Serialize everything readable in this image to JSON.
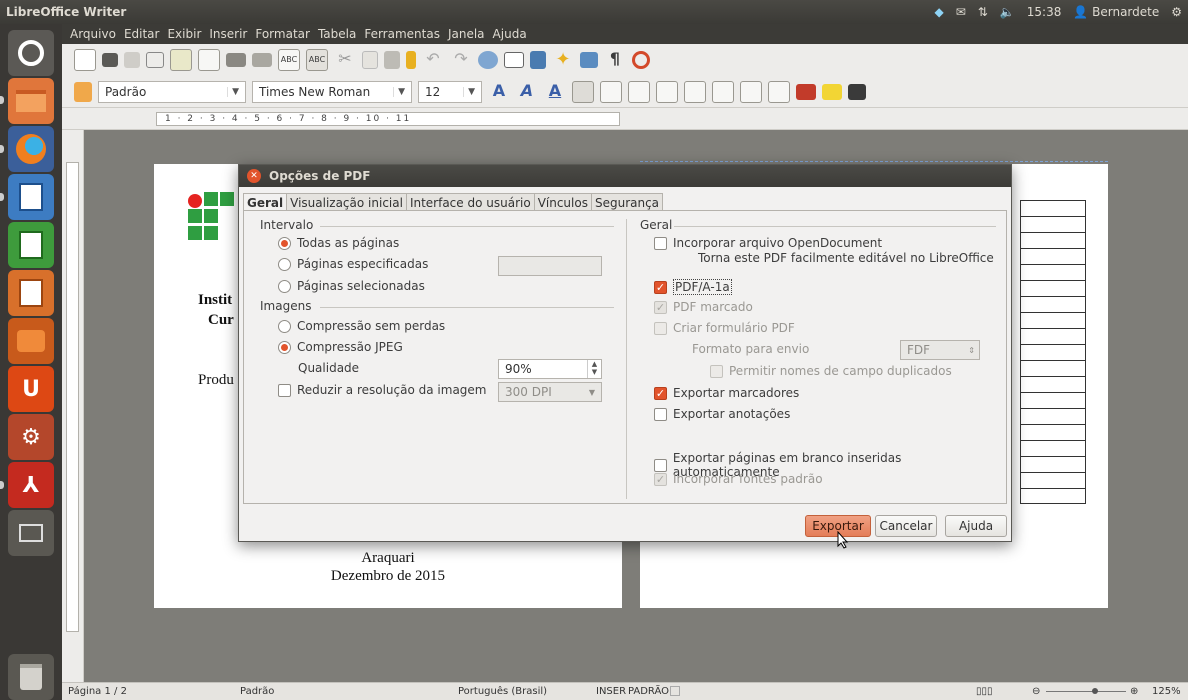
{
  "topbar": {
    "app_name": "LibreOffice Writer",
    "clock": "15:38",
    "user": "Bernardete"
  },
  "menu": [
    "Arquivo",
    "Editar",
    "Exibir",
    "Inserir",
    "Formatar",
    "Tabela",
    "Ferramentas",
    "Janela",
    "Ajuda"
  ],
  "format_toolbar": {
    "paragraph_style": "Padrão",
    "font_name": "Times New Roman",
    "font_size": "12"
  },
  "ruler": {
    "marks": "1 · 2 · 3 · 4 · 5 · 6 · 7 · 8 · 9 · 10 · 11"
  },
  "document": {
    "line1": "Instit",
    "line2": "Cur",
    "line3": "Produ",
    "city": "Araquari",
    "date": "Dezembro de 2015"
  },
  "dialog": {
    "title": "Opções de PDF",
    "tabs": [
      "Geral",
      "Visualização inicial",
      "Interface do usuário",
      "Vínculos",
      "Segurança"
    ],
    "left": {
      "range_group": "Intervalo",
      "all_pages": "Todas as páginas",
      "specified_pages": "Páginas especificadas",
      "selected_pages": "Páginas selecionadas",
      "images_group": "Imagens",
      "lossless": "Compressão sem perdas",
      "jpeg": "Compressão JPEG",
      "quality_label": "Qualidade",
      "quality_value": "90%",
      "reduce_resolution": "Reduzir a resolução da imagem",
      "resolution_value": "300 DPI"
    },
    "right": {
      "group": "Geral",
      "embed_odf": "Incorporar arquivo OpenDocument",
      "embed_odf_hint": "Torna este PDF facilmente editável no LibreOffice",
      "pdfa": "PDF/A-1a",
      "tagged": "PDF marcado",
      "create_form": "Criar formulário PDF",
      "submit_format_label": "Formato para envio",
      "submit_format_value": "FDF",
      "allow_duplicate": "Permitir nomes de campo duplicados",
      "export_bookmarks": "Exportar marcadores",
      "export_comments": "Exportar anotações",
      "export_blank": "Exportar páginas em branco inseridas automaticamente",
      "embed_fonts": "Incorporar fontes padrão"
    },
    "buttons": {
      "export": "Exportar",
      "cancel": "Cancelar",
      "help": "Ajuda"
    }
  },
  "status": {
    "page": "Página 1 / 2",
    "style": "Padrão",
    "language": "Português (Brasil)",
    "mode": "INSER",
    "selection": "PADRÃO",
    "zoom": "125%"
  },
  "colors": {
    "accent": "#e2542c",
    "logo_red": "#e52320",
    "logo_green": "#2f9e41"
  }
}
